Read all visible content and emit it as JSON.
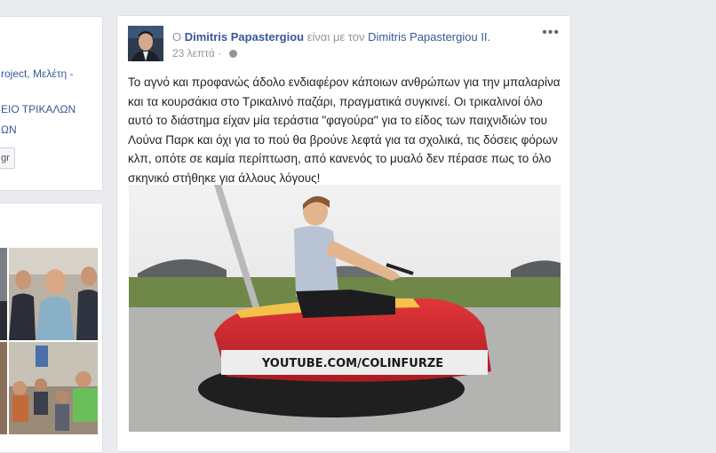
{
  "left_card": {
    "link1": "roject, Μελέτη -",
    "link2": "ΕΙΟ ΤΡΙΚΑΛΩΝ",
    "link3": "ΩΝ",
    "button": "gr"
  },
  "post": {
    "prefix": "Ο",
    "author": "Dimitris Papastergiou",
    "with_text": "είναι με τον",
    "tagged": "Dimitris Papastergiou II.",
    "time": "23 λεπτά",
    "dot": "·",
    "more": "•••",
    "body": "Το αγνό και προφανώς άδολο ενδιαφέρον κάποιων ανθρώπων για την μπαλαρίνα και τα κουρσάκια στο Τρικαλινό παζάρι, πραγματικά συγκινεί. Οι τρικαλινοί όλο αυτό το διάστημα είχαν μία τεράστια \"φαγούρα\" για το είδος των παιχνιδιών του Λούνα Παρκ και όχι για το πού θα βρούνε λεφτά για τα σχολικά, τις δόσεις φόρων κλπ, οπότε σε καμία περίπτωση, από κανενός το μυαλό δεν πέρασε πως το όλο σκηνικό στήθηκε για άλλους λόγους!",
    "image_caption": "YOUTUBE.COM/COLINFURZE"
  }
}
